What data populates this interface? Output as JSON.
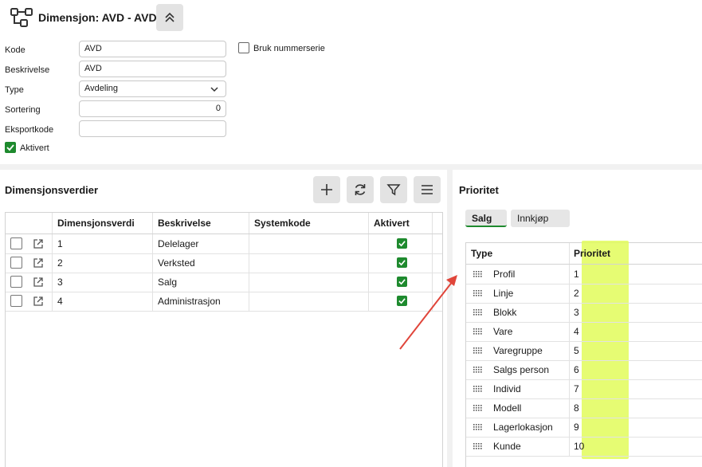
{
  "header": {
    "title": "Dimensjon: AVD - AVD",
    "icon": "hierarchy-icon",
    "collapse_icon": "chevron-double-up-icon"
  },
  "form": {
    "kode_label": "Kode",
    "kode_value": "AVD",
    "beskrivelse_label": "Beskrivelse",
    "beskrivelse_value": "AVD",
    "type_label": "Type",
    "type_value": "Avdeling",
    "sortering_label": "Sortering",
    "sortering_value": "0",
    "eksportkode_label": "Eksportkode",
    "eksportkode_value": "",
    "aktivert_label": "Aktivert",
    "aktivert_checked": true,
    "bruk_nummerserie_label": "Bruk nummerserie",
    "bruk_nummerserie_checked": false
  },
  "values_panel": {
    "title": "Dimensjonsverdier",
    "toolbar": [
      "plus-icon",
      "refresh-icon",
      "filter-icon",
      "menu-icon"
    ],
    "columns": [
      "Dimensjonsverdi",
      "Beskrivelse",
      "Systemkode",
      "Aktivert"
    ],
    "rows": [
      {
        "verdi": "1",
        "beskrivelse": "Delelager",
        "systemkode": "",
        "aktivert": true
      },
      {
        "verdi": "2",
        "beskrivelse": "Verksted",
        "systemkode": "",
        "aktivert": true
      },
      {
        "verdi": "3",
        "beskrivelse": "Salg",
        "systemkode": "",
        "aktivert": true
      },
      {
        "verdi": "4",
        "beskrivelse": "Administrasjon",
        "systemkode": "",
        "aktivert": true
      }
    ]
  },
  "priority_panel": {
    "title": "Prioritet",
    "tabs": [
      {
        "label": "Salg",
        "active": true
      },
      {
        "label": "Innkjøp",
        "active": false
      }
    ],
    "columns": [
      "Type",
      "Prioritet"
    ],
    "rows": [
      {
        "type": "Profil",
        "prioritet": "1"
      },
      {
        "type": "Linje",
        "prioritet": "2"
      },
      {
        "type": "Blokk",
        "prioritet": "3"
      },
      {
        "type": "Vare",
        "prioritet": "4"
      },
      {
        "type": "Varegruppe",
        "prioritet": "5"
      },
      {
        "type": "Salgs person",
        "prioritet": "6"
      },
      {
        "type": "Individ",
        "prioritet": "7"
      },
      {
        "type": "Modell",
        "prioritet": "8"
      },
      {
        "type": "Lagerlokasjon",
        "prioritet": "9"
      },
      {
        "type": "Kunde",
        "prioritet": "10"
      }
    ],
    "highlight_color": "#e2fb5a",
    "arrow_color": "#e0453a"
  },
  "colors": {
    "accent": "#1e8a2e"
  }
}
